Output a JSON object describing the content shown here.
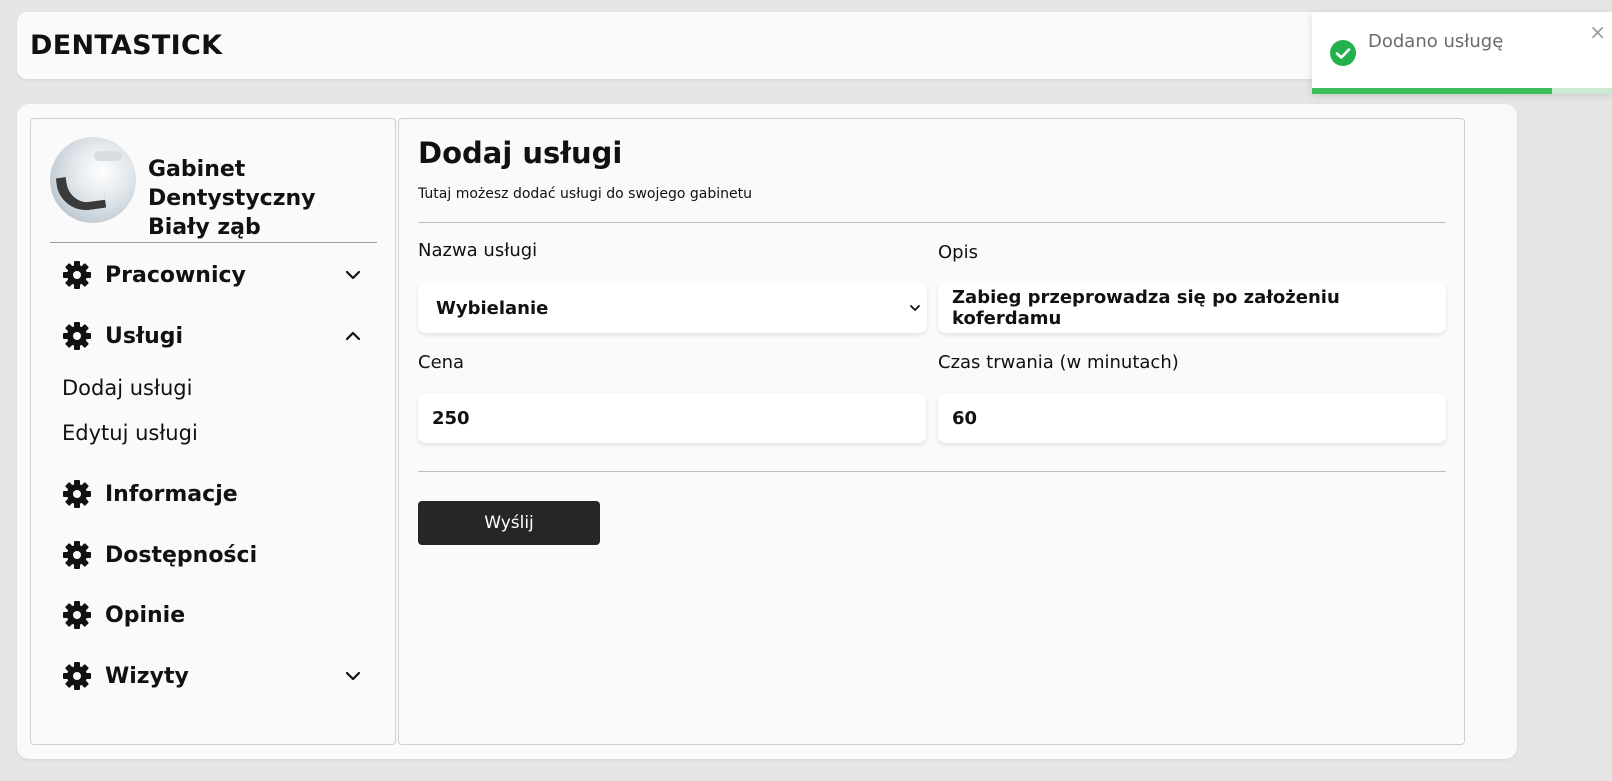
{
  "app": {
    "brand": "DENTASTICK"
  },
  "clinic": {
    "name": "Gabinet Dentystyczny Biały ząb"
  },
  "sidebar": {
    "items": [
      {
        "label": "Pracownicy",
        "icon": "gear-icon",
        "chevron": "chevron-down-icon"
      },
      {
        "label": "Usługi",
        "icon": "gear-icon",
        "chevron": "chevron-up-icon",
        "children": [
          {
            "label": "Dodaj usługi"
          },
          {
            "label": "Edytuj usługi"
          }
        ]
      },
      {
        "label": "Informacje",
        "icon": "gear-icon"
      },
      {
        "label": "Dostępności",
        "icon": "gear-icon"
      },
      {
        "label": "Opinie",
        "icon": "gear-icon"
      },
      {
        "label": "Wizyty",
        "icon": "gear-icon",
        "chevron": "chevron-down-icon"
      }
    ]
  },
  "main": {
    "title": "Dodaj usługi",
    "subtitle": "Tutaj możesz dodać usługi do swojego gabinetu",
    "form": {
      "service_name": {
        "label": "Nazwa usługi",
        "value": "Wybielanie"
      },
      "description": {
        "label": "Opis",
        "value": "Zabieg przeprowadza się po założeniu koferdamu"
      },
      "price": {
        "label": "Cena",
        "value": "250"
      },
      "duration": {
        "label": "Czas trwania (w minutach)",
        "value": "60"
      },
      "submit_label": "Wyślij"
    }
  },
  "toast": {
    "message": "Dodano usługę",
    "icon": "check-circle-icon",
    "close_glyph": "×",
    "progress_fraction": 0.8,
    "color": "#22b14c"
  }
}
